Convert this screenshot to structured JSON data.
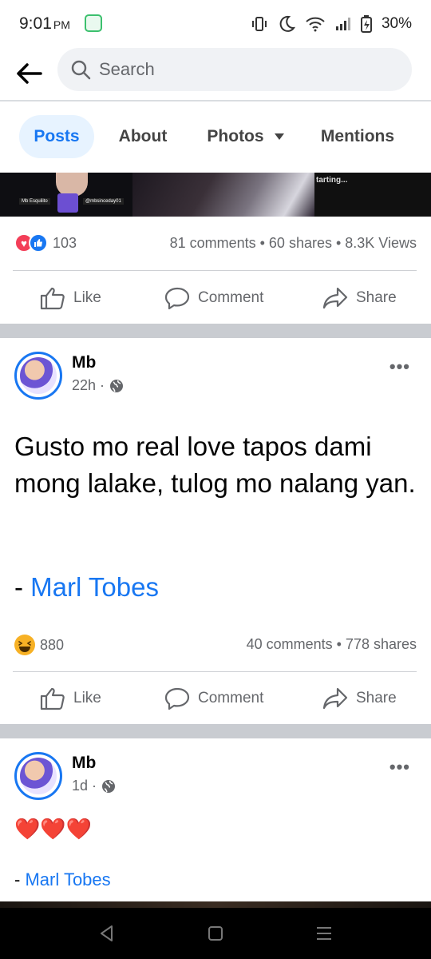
{
  "status_bar": {
    "time": "9:01",
    "ampm": "PM",
    "battery": "30%"
  },
  "search": {
    "placeholder": "Search"
  },
  "tabs": [
    {
      "label": "Posts",
      "active": true
    },
    {
      "label": "About",
      "active": false
    },
    {
      "label": "Photos",
      "active": false
    },
    {
      "label": "Mentions",
      "active": false
    }
  ],
  "media_strip": {
    "tag_1": "Mb Esquilito",
    "tag_2": "@mbsinceday01",
    "right_text": "tarting..."
  },
  "post_1": {
    "reaction_count": "103",
    "stats": "81 comments • 60 shares • 8.3K Views"
  },
  "actions": {
    "like": "Like",
    "comment": "Comment",
    "share": "Share"
  },
  "post_2": {
    "author": "Mb",
    "time": "22h ·",
    "body": "Gusto mo real love tapos dami mong lalake, tulog mo nalang yan.",
    "credit_prefix": "- ",
    "credit_name": "Marl Tobes",
    "reaction_count": "880",
    "stats": "40 comments • 778 shares"
  },
  "post_3": {
    "author": "Mb",
    "time": "1d ·",
    "body": "❤️❤️❤️",
    "credit_prefix": "- ",
    "credit_name": "Marl Tobes"
  },
  "colors": {
    "accent": "#1877f2",
    "secondary_text": "#65676b",
    "active_tab_bg": "#e7f3ff",
    "section_gap": "#c9ccd1"
  }
}
